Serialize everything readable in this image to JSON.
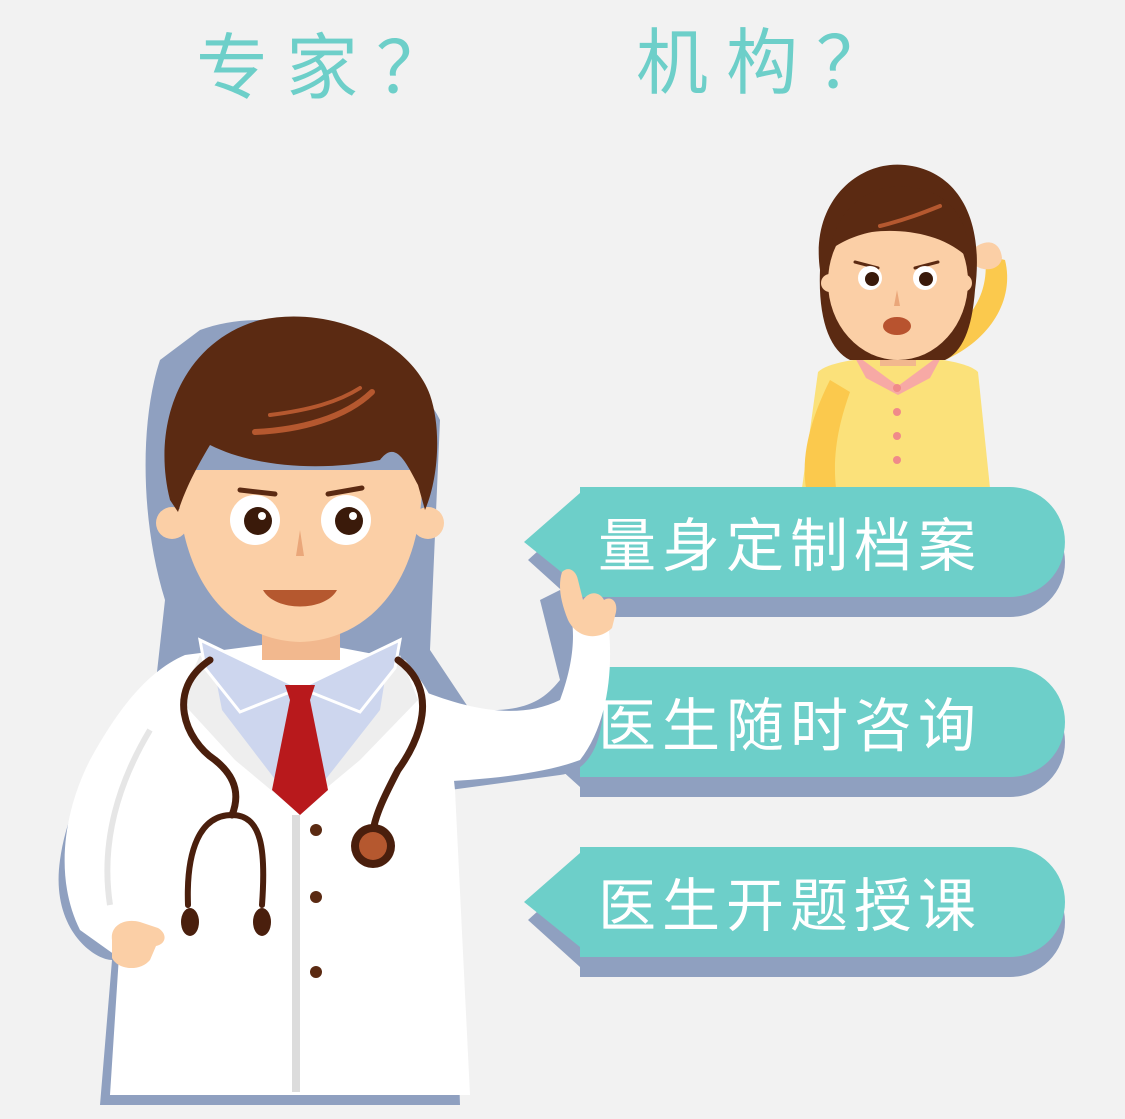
{
  "header": {
    "question_experts": "专家？",
    "question_institutions": "机构？"
  },
  "services": {
    "items": [
      {
        "label": "量身定制档案"
      },
      {
        "label": "医生随时咨询"
      },
      {
        "label": "医生开题授课"
      }
    ]
  },
  "colors": {
    "background": "#f2f2f2",
    "accent_teal": "#6dcfc9",
    "bubble_shadow": "#8fa0c0",
    "hair_brown": "#5b2a12",
    "skin": "#fbcfa6",
    "coat_white": "#ffffff",
    "tie_red": "#b8191c",
    "shirt_blue": "#cdd6ee",
    "woman_shirt_yellow": "#fbe17a",
    "woman_collar_pink": "#f7a9a5"
  }
}
